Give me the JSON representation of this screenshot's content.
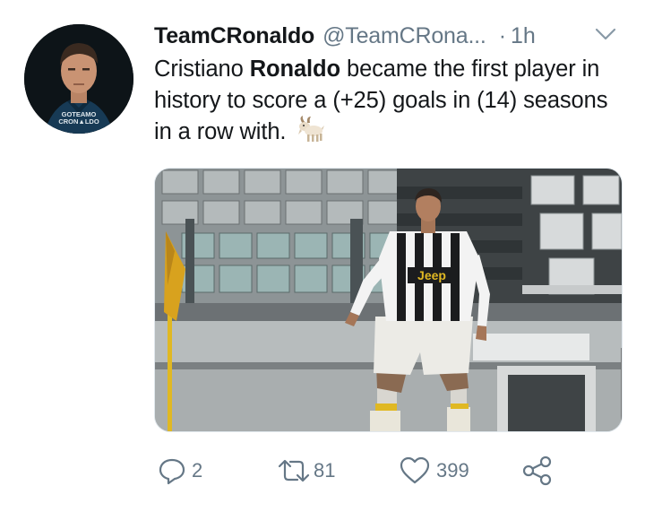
{
  "tweet": {
    "author": {
      "display_name": "TeamCRonaldo",
      "handle": "@TeamCRona...",
      "avatar_watermark_line1": "GOTEAMO",
      "avatar_watermark_line2": "CRON▲LDO"
    },
    "dot": "·",
    "time": "1h",
    "text": {
      "part1": "Cristiano ",
      "bold": "Ronaldo",
      "part2": " became the first player in history to score a (+25) goals in (14) seasons in a row with."
    },
    "emoji": "goat",
    "media": {
      "jersey_text": "Jeep"
    },
    "actions": {
      "reply_count": "2",
      "retweet_count": "81",
      "like_count": "399"
    },
    "colors": {
      "text": "#14171a",
      "secondary": "#657786",
      "border": "#e1e8ed"
    }
  }
}
